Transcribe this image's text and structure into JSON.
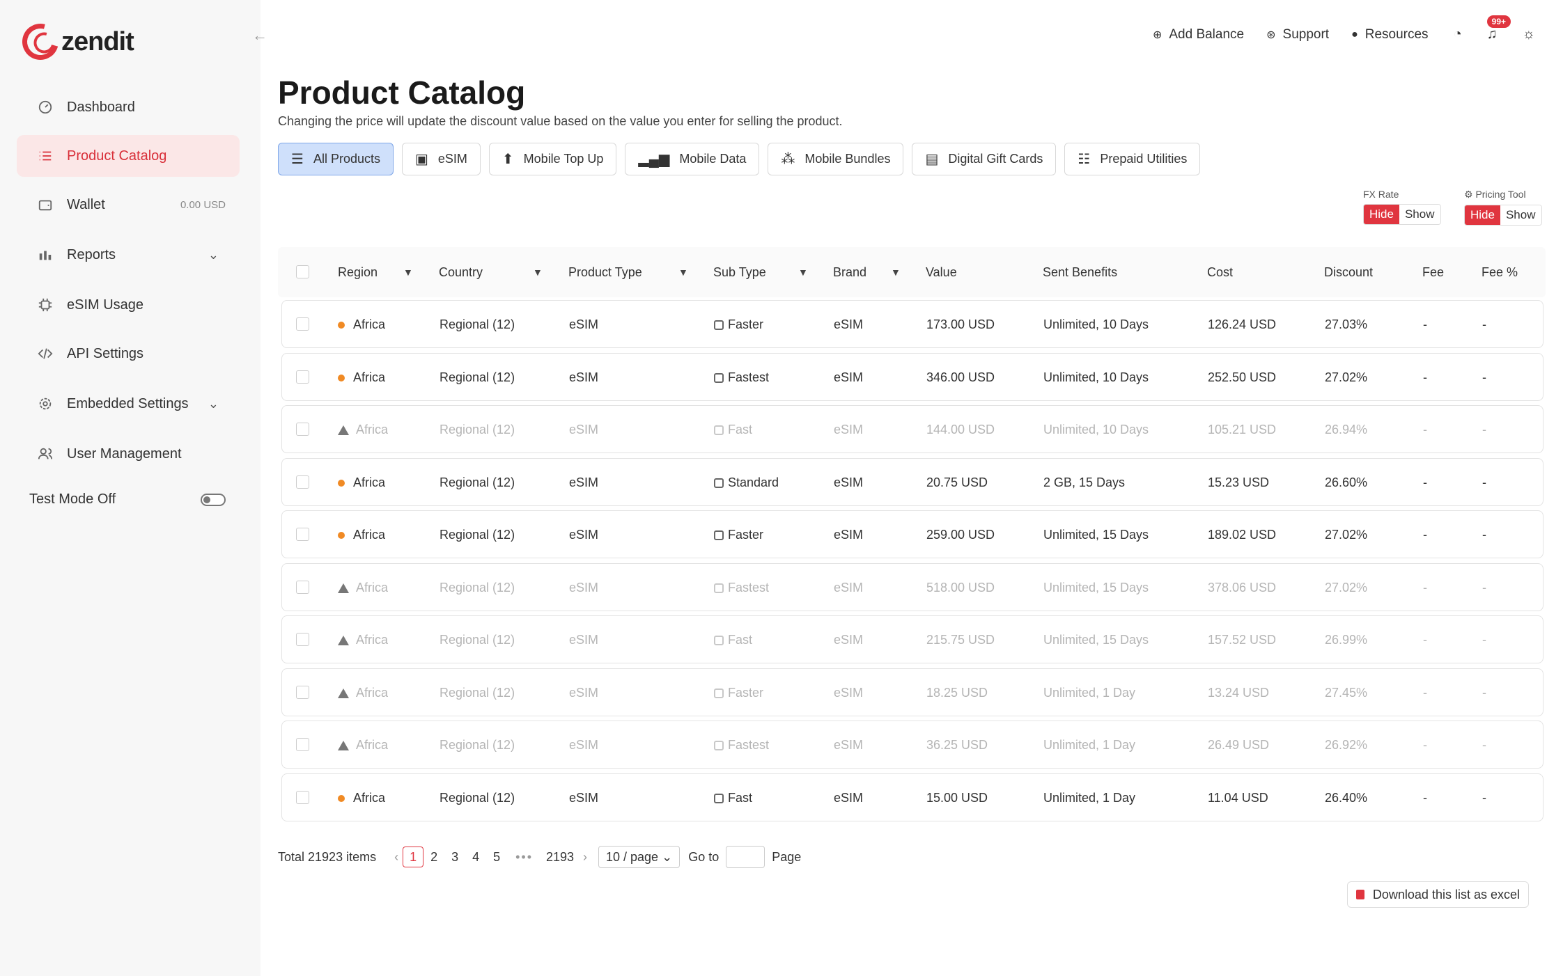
{
  "brand": {
    "name": "zendit",
    "accent": "#e0353f"
  },
  "sidebar": {
    "items": [
      {
        "label": "Dashboard",
        "icon": "dashboard-icon"
      },
      {
        "label": "Product Catalog",
        "icon": "list-icon",
        "active": true
      },
      {
        "label": "Wallet",
        "icon": "wallet-icon",
        "meta": "0.00 USD"
      },
      {
        "label": "Reports",
        "icon": "bar-chart-icon",
        "expandable": true
      },
      {
        "label": "eSIM Usage",
        "icon": "chip-icon"
      },
      {
        "label": "API Settings",
        "icon": "code-icon"
      },
      {
        "label": "Embedded Settings",
        "icon": "gear-icon",
        "expandable": true
      },
      {
        "label": "User Management",
        "icon": "users-icon"
      }
    ],
    "test_mode_label": "Test Mode Off"
  },
  "topbar": {
    "add_balance": "Add Balance",
    "support": "Support",
    "resources": "Resources",
    "notifications_badge": "99+"
  },
  "page": {
    "title": "Product Catalog",
    "subtitle": "Changing the price will update the discount value based on the value you enter for selling the product."
  },
  "tabs": [
    {
      "label": "All Products",
      "icon": "list-icon",
      "active": true
    },
    {
      "label": "eSIM",
      "icon": "chip-icon"
    },
    {
      "label": "Mobile Top Up",
      "icon": "arrow-up-icon"
    },
    {
      "label": "Mobile Data",
      "icon": "signal-icon"
    },
    {
      "label": "Mobile Bundles",
      "icon": "bundle-icon"
    },
    {
      "label": "Digital Gift Cards",
      "icon": "gift-icon"
    },
    {
      "label": "Prepaid Utilities",
      "icon": "utilities-icon"
    }
  ],
  "fx_rate": {
    "label": "FX Rate",
    "hide": "Hide",
    "show": "Show"
  },
  "pricing_tool": {
    "label": "Pricing Tool",
    "hide": "Hide",
    "show": "Show"
  },
  "table": {
    "columns": [
      "Region",
      "Country",
      "Product Type",
      "Sub Type",
      "Brand",
      "Value",
      "Sent Benefits",
      "Cost",
      "Discount",
      "Fee",
      "Fee %"
    ],
    "rows": [
      {
        "status": "active",
        "region": "Africa",
        "country": "Regional (12)",
        "product_type": "eSIM",
        "sub_type": "Faster",
        "brand": "eSIM",
        "value": "173.00 USD",
        "benefits": "Unlimited, 10 Days",
        "cost": "126.24 USD",
        "discount": "27.03%",
        "fee": "-",
        "fee_pct": "-"
      },
      {
        "status": "active",
        "region": "Africa",
        "country": "Regional (12)",
        "product_type": "eSIM",
        "sub_type": "Fastest",
        "brand": "eSIM",
        "value": "346.00 USD",
        "benefits": "Unlimited, 10 Days",
        "cost": "252.50 USD",
        "discount": "27.02%",
        "fee": "-",
        "fee_pct": "-"
      },
      {
        "status": "disabled",
        "region": "Africa",
        "country": "Regional (12)",
        "product_type": "eSIM",
        "sub_type": "Fast",
        "brand": "eSIM",
        "value": "144.00 USD",
        "benefits": "Unlimited, 10 Days",
        "cost": "105.21 USD",
        "discount": "26.94%",
        "fee": "-",
        "fee_pct": "-"
      },
      {
        "status": "active",
        "region": "Africa",
        "country": "Regional (12)",
        "product_type": "eSIM",
        "sub_type": "Standard",
        "brand": "eSIM",
        "value": "20.75 USD",
        "benefits": "2 GB, 15 Days",
        "cost": "15.23 USD",
        "discount": "26.60%",
        "fee": "-",
        "fee_pct": "-"
      },
      {
        "status": "active",
        "region": "Africa",
        "country": "Regional (12)",
        "product_type": "eSIM",
        "sub_type": "Faster",
        "brand": "eSIM",
        "value": "259.00 USD",
        "benefits": "Unlimited, 15 Days",
        "cost": "189.02 USD",
        "discount": "27.02%",
        "fee": "-",
        "fee_pct": "-"
      },
      {
        "status": "disabled",
        "region": "Africa",
        "country": "Regional (12)",
        "product_type": "eSIM",
        "sub_type": "Fastest",
        "brand": "eSIM",
        "value": "518.00 USD",
        "benefits": "Unlimited, 15 Days",
        "cost": "378.06 USD",
        "discount": "27.02%",
        "fee": "-",
        "fee_pct": "-"
      },
      {
        "status": "disabled",
        "region": "Africa",
        "country": "Regional (12)",
        "product_type": "eSIM",
        "sub_type": "Fast",
        "brand": "eSIM",
        "value": "215.75 USD",
        "benefits": "Unlimited, 15 Days",
        "cost": "157.52 USD",
        "discount": "26.99%",
        "fee": "-",
        "fee_pct": "-"
      },
      {
        "status": "disabled",
        "region": "Africa",
        "country": "Regional (12)",
        "product_type": "eSIM",
        "sub_type": "Faster",
        "brand": "eSIM",
        "value": "18.25 USD",
        "benefits": "Unlimited, 1 Day",
        "cost": "13.24 USD",
        "discount": "27.45%",
        "fee": "-",
        "fee_pct": "-"
      },
      {
        "status": "disabled",
        "region": "Africa",
        "country": "Regional (12)",
        "product_type": "eSIM",
        "sub_type": "Fastest",
        "brand": "eSIM",
        "value": "36.25 USD",
        "benefits": "Unlimited, 1 Day",
        "cost": "26.49 USD",
        "discount": "26.92%",
        "fee": "-",
        "fee_pct": "-"
      },
      {
        "status": "active",
        "region": "Africa",
        "country": "Regional (12)",
        "product_type": "eSIM",
        "sub_type": "Fast",
        "brand": "eSIM",
        "value": "15.00 USD",
        "benefits": "Unlimited, 1 Day",
        "cost": "11.04 USD",
        "discount": "26.40%",
        "fee": "-",
        "fee_pct": "-"
      }
    ]
  },
  "pagination": {
    "total": "Total 21923 items",
    "pages": [
      "1",
      "2",
      "3",
      "4",
      "5"
    ],
    "last_page": "2193",
    "current": "1",
    "per_page": "10 / page",
    "goto_label": "Go to",
    "page_label": "Page"
  },
  "download_label": "Download this list as excel"
}
